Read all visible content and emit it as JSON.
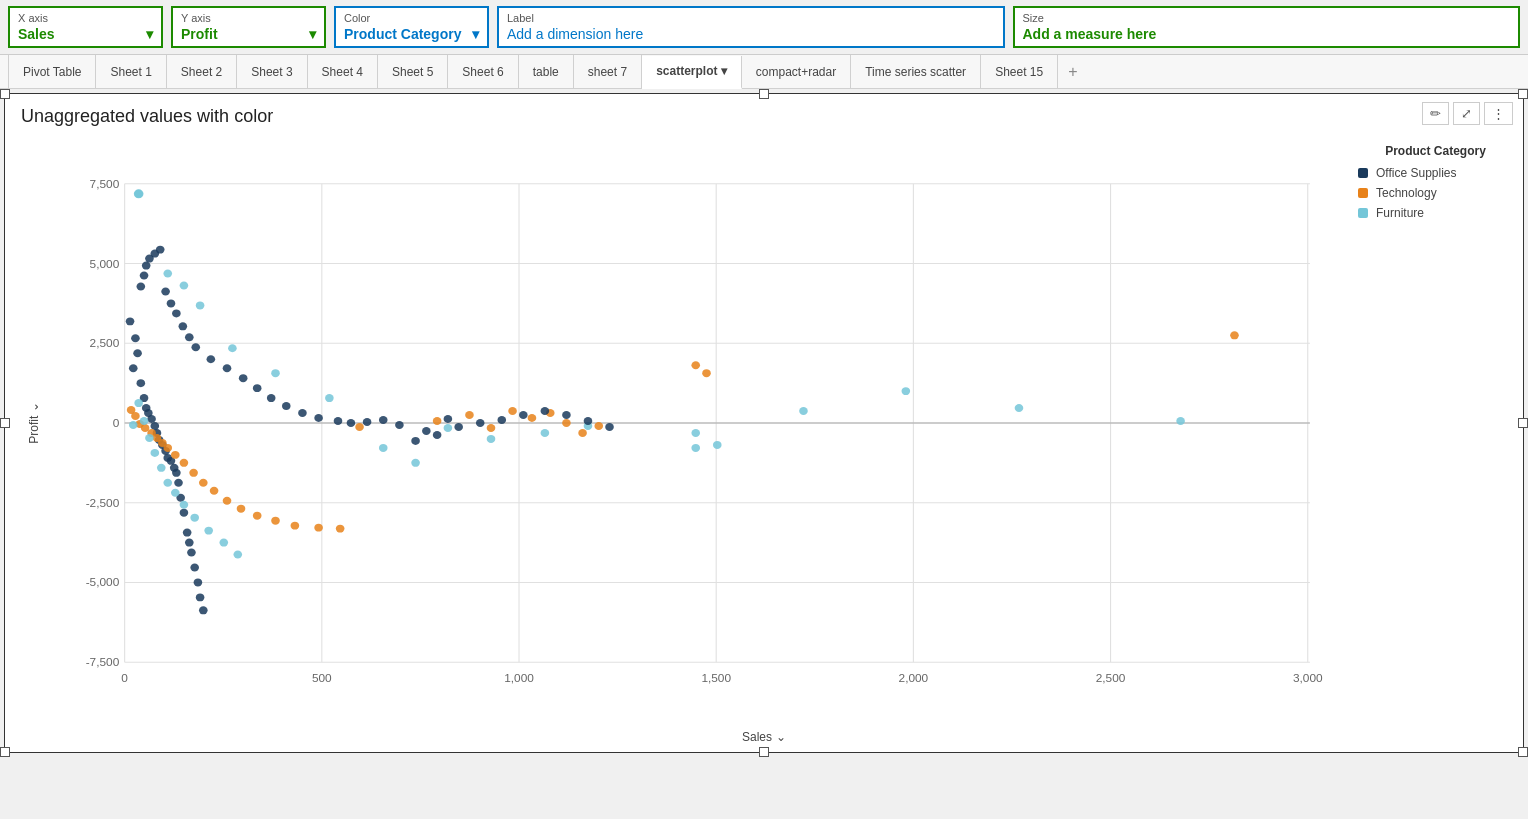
{
  "shelf": {
    "xaxis": {
      "label": "X axis",
      "value": "Sales"
    },
    "yaxis": {
      "label": "Y axis",
      "value": "Profit"
    },
    "color": {
      "label": "Color",
      "value": "Product Category"
    },
    "labelField": {
      "label": "Label",
      "placeholder": "Add a dimension here"
    },
    "size": {
      "label": "Size",
      "placeholder": "Add a measure here"
    }
  },
  "tabs": [
    {
      "id": "pivot-table",
      "label": "Pivot Table",
      "active": false
    },
    {
      "id": "sheet-1",
      "label": "Sheet 1",
      "active": false
    },
    {
      "id": "sheet-2",
      "label": "Sheet 2",
      "active": false
    },
    {
      "id": "sheet-3",
      "label": "Sheet 3",
      "active": false
    },
    {
      "id": "sheet-4",
      "label": "Sheet 4",
      "active": false
    },
    {
      "id": "sheet-5",
      "label": "Sheet 5",
      "active": false
    },
    {
      "id": "sheet-6",
      "label": "Sheet 6",
      "active": false
    },
    {
      "id": "table",
      "label": "table",
      "active": false
    },
    {
      "id": "sheet-7",
      "label": "sheet 7",
      "active": false
    },
    {
      "id": "scatterplot",
      "label": "scatterplot",
      "active": true
    },
    {
      "id": "compact-radar",
      "label": "compact+radar",
      "active": false
    },
    {
      "id": "time-series-scatter",
      "label": "Time series scatter",
      "active": false
    },
    {
      "id": "sheet-15",
      "label": "Sheet 15",
      "active": false
    }
  ],
  "chart": {
    "title": "Unaggregated values with color",
    "xAxisLabel": "Sales",
    "yAxisLabel": "Profit",
    "legend": {
      "title": "Product Category",
      "items": [
        {
          "label": "Office Supplies",
          "color": "#1a3a5c"
        },
        {
          "label": "Technology",
          "color": "#e8821a"
        },
        {
          "label": "Furniture",
          "color": "#74c6d8"
        }
      ]
    },
    "xTicks": [
      "0",
      "500",
      "1,000",
      "1,500",
      "2,000",
      "2,500",
      "3,000"
    ],
    "yTicks": [
      "7,500",
      "5,000",
      "2,500",
      "0",
      "-2,500",
      "-5,000",
      "-7,500"
    ],
    "actions": [
      {
        "id": "edit",
        "icon": "✏"
      },
      {
        "id": "expand",
        "icon": "⤢"
      },
      {
        "id": "more",
        "icon": "⋮"
      }
    ]
  }
}
